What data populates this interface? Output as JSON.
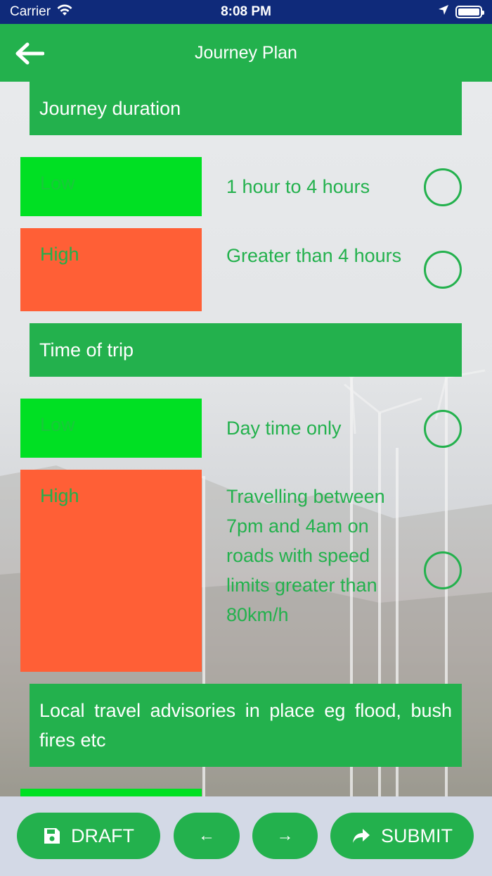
{
  "status_bar": {
    "carrier": "Carrier",
    "time": "8:08 PM",
    "icons": [
      "wifi-icon",
      "location-arrow-icon",
      "battery-icon"
    ]
  },
  "nav": {
    "title": "Journey Plan",
    "back_icon": "arrow-left-icon"
  },
  "sections": [
    {
      "title": "Journey duration",
      "options": [
        {
          "risk": "Low",
          "text": "1 hour to 4 hours",
          "selected": false
        },
        {
          "risk": "High",
          "text": "Greater than 4 hours",
          "selected": false
        }
      ]
    },
    {
      "title": "Time of trip",
      "options": [
        {
          "risk": "Low",
          "text": "Day time only",
          "selected": false
        },
        {
          "risk": "High",
          "text": "Travelling between 7pm and 4am on roads with speed limits greater than 80km/h",
          "selected": false
        }
      ]
    },
    {
      "title": "Local travel advisories in place eg flood, bush fires etc",
      "options": []
    }
  ],
  "toolbar": {
    "draft_label": "DRAFT",
    "prev_label": "←",
    "next_label": "→",
    "submit_label": "SUBMIT",
    "draft_icon": "save-icon",
    "submit_icon": "share-icon"
  },
  "colors": {
    "primary_green": "#23b14d",
    "low_risk": "#00e023",
    "high_risk": "#ff5f36",
    "status_bar": "#0f2a7a",
    "toolbar_bg": "#d3d9e6"
  }
}
